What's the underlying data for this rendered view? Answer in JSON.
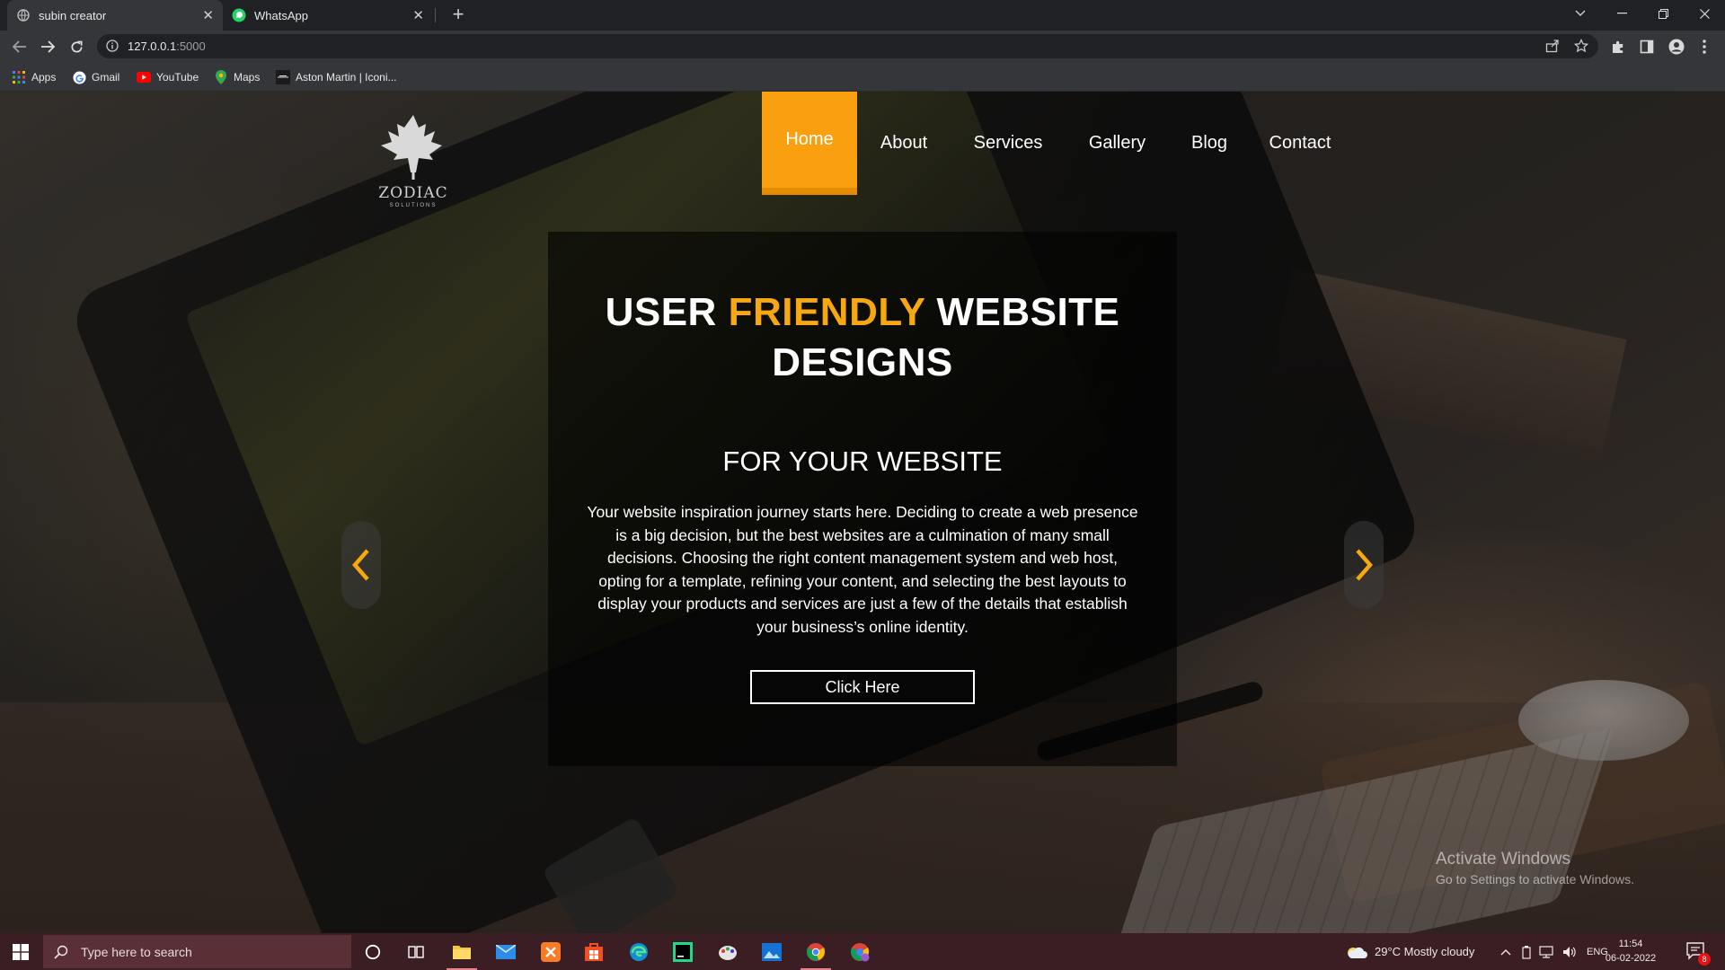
{
  "browser": {
    "tabs": [
      {
        "title": "subin creator",
        "active": true,
        "favicon": "globe-icon"
      },
      {
        "title": "WhatsApp",
        "active": false,
        "favicon": "whatsapp-icon"
      }
    ],
    "url_host": "127.0.0.1",
    "url_port": ":5000",
    "bookmarks": [
      {
        "label": "Apps",
        "icon": "apps-grid-icon"
      },
      {
        "label": "Gmail",
        "icon": "google-icon"
      },
      {
        "label": "YouTube",
        "icon": "youtube-icon"
      },
      {
        "label": "Maps",
        "icon": "maps-icon"
      },
      {
        "label": "Aston Martin | Iconi...",
        "icon": "aston-martin-icon"
      }
    ]
  },
  "site": {
    "logo": {
      "name": "ZODIAC",
      "sub": "SOLUTIONS"
    },
    "nav": [
      {
        "label": "Home",
        "active": true
      },
      {
        "label": "About",
        "active": false
      },
      {
        "label": "Services",
        "active": false
      },
      {
        "label": "Gallery",
        "active": false
      },
      {
        "label": "Blog",
        "active": false
      },
      {
        "label": "Contact",
        "active": false
      }
    ],
    "hero": {
      "title_part1": "USER ",
      "title_highlight": "FRIENDLY",
      "title_part2": " WEBSITE DESIGNS",
      "subtitle": "FOR YOUR WEBSITE",
      "body": "Your website inspiration journey starts here. Deciding to create a web presence is a big decision, but the best websites are a culmination of many small decisions. Choosing the right content management system and web host, opting for a template, refining your content, and selecting the best layouts to display your products and services are just a few of the details that establish your business’s online identity.",
      "cta": "Click Here"
    },
    "colors": {
      "accent": "#fa9f0f",
      "highlight": "#f7a70f"
    }
  },
  "os": {
    "watermark_title": "Activate Windows",
    "watermark_sub": "Go to Settings to activate Windows.",
    "search_placeholder": "Type here to search",
    "weather": "29°C  Mostly cloudy",
    "language": "ENG",
    "time": "11:54",
    "date": "06-02-2022",
    "notification_count": "8"
  }
}
